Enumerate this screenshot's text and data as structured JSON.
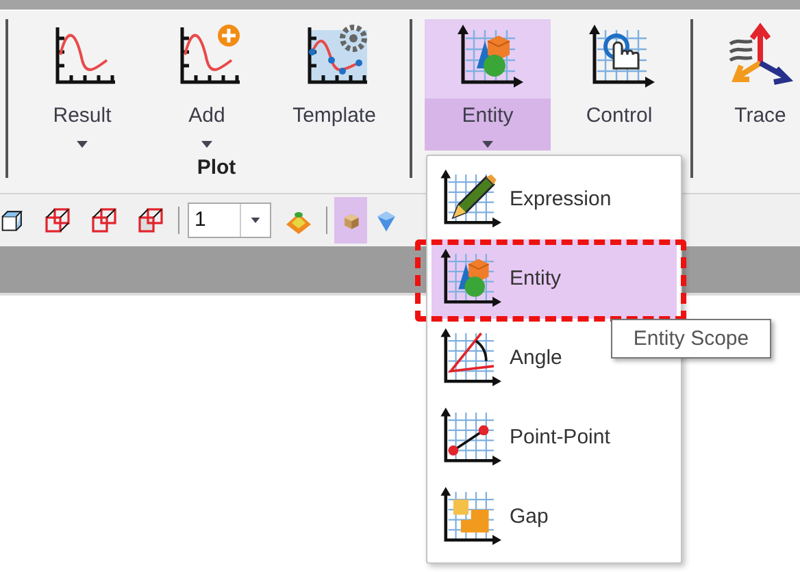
{
  "ribbon": {
    "groups": [
      {
        "label": "Plot",
        "buttons": [
          {
            "label": "Result",
            "dropdown": true,
            "selected": false
          },
          {
            "label": "Add",
            "dropdown": true,
            "selected": false
          },
          {
            "label": "Template",
            "dropdown": false,
            "selected": false
          }
        ]
      },
      {
        "buttons": [
          {
            "label": "Entity",
            "dropdown": true,
            "selected": true
          },
          {
            "label": "Control",
            "dropdown": false,
            "selected": false
          }
        ]
      },
      {
        "buttons": [
          {
            "label": "Trace",
            "dropdown": false,
            "selected": false
          }
        ]
      }
    ]
  },
  "toolbar": [
    {
      "kind": "tool",
      "selected": false
    },
    {
      "kind": "tool",
      "selected": false
    },
    {
      "kind": "tool",
      "selected": false
    },
    {
      "kind": "tool",
      "selected": false
    },
    {
      "kind": "separator"
    },
    {
      "kind": "combo",
      "value": "1"
    },
    {
      "kind": "tool",
      "selected": false
    },
    {
      "kind": "separator"
    },
    {
      "kind": "tool",
      "selected": true
    },
    {
      "kind": "tool",
      "selected": false
    }
  ],
  "menu": {
    "items": [
      {
        "label": "Expression",
        "selected": false,
        "highlighted": false
      },
      {
        "label": "Entity",
        "selected": true,
        "highlighted": true
      },
      {
        "label": "Angle",
        "selected": false,
        "highlighted": false
      },
      {
        "label": "Point-Point",
        "selected": false,
        "highlighted": false
      },
      {
        "label": "Gap",
        "selected": false,
        "highlighted": false
      }
    ]
  },
  "tooltip": {
    "text": "Entity Scope"
  }
}
